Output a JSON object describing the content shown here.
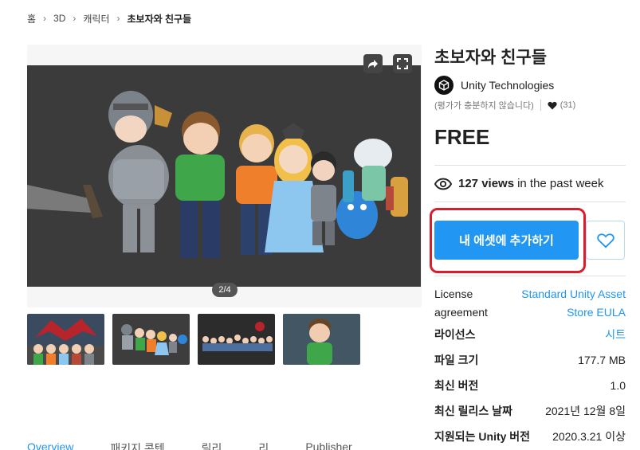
{
  "breadcrumb": {
    "home": "홈",
    "category": "3D",
    "subcategory": "캐릭터",
    "current": "초보자와 친구들"
  },
  "gallery": {
    "page_indicator": "2/4",
    "share_icon": "share-icon",
    "fullscreen_icon": "fullscreen-icon",
    "thumbnail_count": 4
  },
  "product": {
    "title": "초보자와 친구들",
    "publisher": "Unity Technologies",
    "rating_text": "(평가가 충분하지 않습니다)",
    "favorites": "(31)",
    "price": "FREE",
    "views_count": "127 views",
    "views_suffix": "in the past week"
  },
  "actions": {
    "add_button": "내 에셋에 추가하기",
    "favorite_icon": "heart-icon"
  },
  "details": {
    "license_label": "License agreement",
    "license_link": "Standard Unity Asset Store EULA",
    "rows": [
      {
        "label": "라이선스",
        "value": "시트"
      },
      {
        "label": "파일 크기",
        "value": "177.7 MB"
      },
      {
        "label": "최신 버전",
        "value": "1.0"
      },
      {
        "label": "최신 릴리스 날짜",
        "value": "2021년 12월 8일"
      },
      {
        "label": "지원되는 Unity 버전",
        "value": "2020.3.21 이상"
      }
    ]
  },
  "tabs": [
    "Overview",
    "패키지 콘텐",
    "릴리",
    "리",
    "Publisher"
  ],
  "colors": {
    "accent": "#2196f3",
    "highlight": "#d81e2c",
    "text": "#212121"
  }
}
